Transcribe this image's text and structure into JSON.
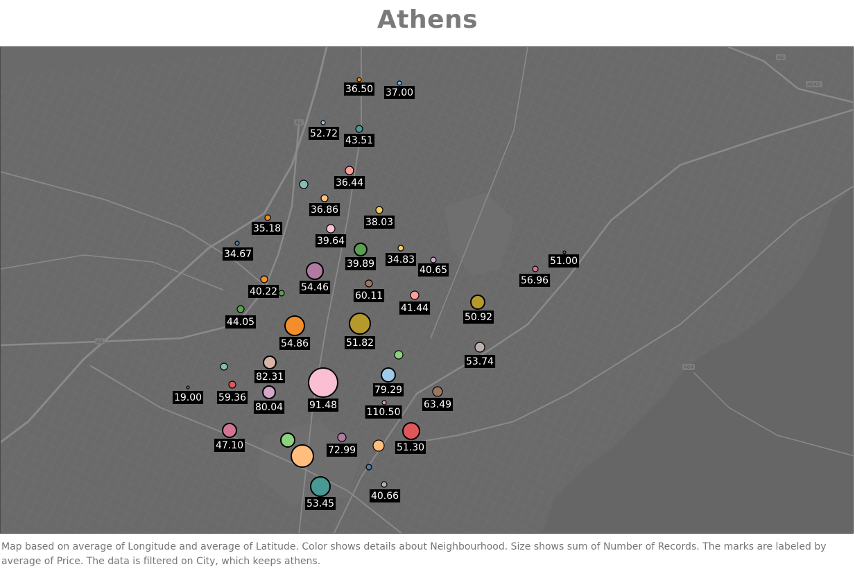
{
  "title": "Athens",
  "caption": "Map based on average of Longitude and average of Latitude.  Color shows details about Neighbourhood.  Size shows sum of Number of Records.  The marks are labeled by average of Price. The data is filtered on City, which keeps athens.",
  "map": {
    "background": "#6a6a6a",
    "road_labels": [
      "A6",
      "A642",
      "A1",
      "A1",
      "A64"
    ],
    "marks": [
      {
        "label": "36.50",
        "color": "#f28e2b"
      },
      {
        "label": "37.00",
        "color": "#76b7ea"
      },
      {
        "label": "52.72",
        "color": "#a0cbe8"
      },
      {
        "label": "43.51",
        "color": "#499894"
      },
      {
        "label": "36.44",
        "color": "#ff9d9a"
      },
      {
        "label": "",
        "color": "#86bcb6"
      },
      {
        "label": "36.86",
        "color": "#ffbe7d"
      },
      {
        "label": "38.03",
        "color": "#f1ce63"
      },
      {
        "label": "35.18",
        "color": "#f28e2b"
      },
      {
        "label": "39.64",
        "color": "#fabfd2"
      },
      {
        "label": "34.67",
        "color": "#4e79a7"
      },
      {
        "label": "39.89",
        "color": "#59a14f"
      },
      {
        "label": "34.83",
        "color": "#f1ce63"
      },
      {
        "label": "40.65",
        "color": "#d4a6c8"
      },
      {
        "label": "51.00",
        "color": "#79706e"
      },
      {
        "label": "56.96",
        "color": "#d37295"
      },
      {
        "label": "54.46",
        "color": "#b07aa1"
      },
      {
        "label": "40.22",
        "color": "#f28e2b"
      },
      {
        "label": "",
        "color": "#59a14f"
      },
      {
        "label": "60.11",
        "color": "#9d7660"
      },
      {
        "label": "41.44",
        "color": "#ff9d9a"
      },
      {
        "label": "50.92",
        "color": "#b6992d"
      },
      {
        "label": "44.05",
        "color": "#59a14f"
      },
      {
        "label": "54.86",
        "color": "#f28e2b"
      },
      {
        "label": "51.82",
        "color": "#b6992d"
      },
      {
        "label": "",
        "color": "#8cd17d"
      },
      {
        "label": "53.74",
        "color": "#bab0ac"
      },
      {
        "label": "",
        "color": "#86bcb6"
      },
      {
        "label": "82.31",
        "color": "#d7b5a6"
      },
      {
        "label": "91.48",
        "color": "#fabfd2"
      },
      {
        "label": "79.29",
        "color": "#a0cbe8"
      },
      {
        "label": "19.00",
        "color": "#79706e"
      },
      {
        "label": "59.36",
        "color": "#e15759"
      },
      {
        "label": "80.04",
        "color": "#d4a6c8"
      },
      {
        "label": "110.50",
        "color": "#ff9d9a"
      },
      {
        "label": "63.49",
        "color": "#9d7660"
      },
      {
        "label": "47.10",
        "color": "#d37295"
      },
      {
        "label": "",
        "color": "#8cd17d"
      },
      {
        "label": "72.99",
        "color": "#b07aa1"
      },
      {
        "label": "",
        "color": "#ffbe7d"
      },
      {
        "label": "51.30",
        "color": "#e15759"
      },
      {
        "label": "",
        "color": "#ffbe7d"
      },
      {
        "label": "",
        "color": "#4e79a7"
      },
      {
        "label": "53.45",
        "color": "#499894"
      },
      {
        "label": "40.66",
        "color": "#bab0ac"
      }
    ]
  }
}
